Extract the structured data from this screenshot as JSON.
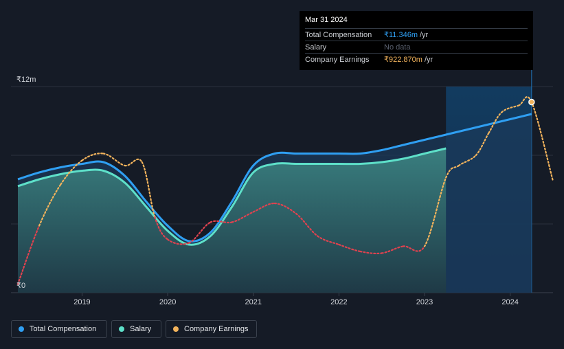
{
  "chart_data": {
    "type": "line",
    "y_axis": {
      "ticks": [
        {
          "value": 0,
          "label": "₹0"
        },
        {
          "value": 12,
          "label": "₹12m"
        }
      ],
      "ylim": [
        0,
        12
      ]
    },
    "x_axis": {
      "ticks": [
        "2019",
        "2020",
        "2021",
        "2022",
        "2023",
        "2024"
      ],
      "xlim": [
        2018.17,
        2024.5
      ]
    },
    "series": [
      {
        "name": "Total Compensation",
        "color": "#2f9ff2",
        "x": [
          2018.25,
          2018.5,
          2018.75,
          2019.0,
          2019.25,
          2019.5,
          2019.75,
          2020.0,
          2020.25,
          2020.5,
          2020.75,
          2021.0,
          2021.25,
          2021.5,
          2021.75,
          2022.0,
          2022.25,
          2022.5,
          2022.75,
          2023.0,
          2023.25,
          2023.5,
          2023.75,
          2024.0,
          2024.25
        ],
        "values": [
          6.6,
          7.0,
          7.3,
          7.5,
          7.6,
          6.8,
          5.3,
          3.9,
          3.0,
          3.5,
          5.3,
          7.4,
          8.1,
          8.1,
          8.1,
          8.1,
          8.1,
          8.3,
          8.6,
          8.9,
          9.2,
          9.5,
          9.8,
          10.1,
          10.4
        ]
      },
      {
        "name": "Salary",
        "color": "#5ee0c9",
        "x": [
          2018.25,
          2018.5,
          2018.75,
          2019.0,
          2019.25,
          2019.5,
          2019.75,
          2020.0,
          2020.25,
          2020.5,
          2020.75,
          2021.0,
          2021.25,
          2021.5,
          2021.75,
          2022.0,
          2022.25,
          2022.5,
          2022.75,
          2023.0,
          2023.25
        ],
        "values": [
          6.2,
          6.6,
          6.9,
          7.1,
          7.1,
          6.4,
          5.0,
          3.6,
          2.8,
          3.3,
          5.0,
          7.0,
          7.5,
          7.5,
          7.5,
          7.5,
          7.5,
          7.6,
          7.8,
          8.1,
          8.4
        ]
      },
      {
        "name": "Company Earnings",
        "colors": {
          "positive": "#f2b35c",
          "negative": "#e0424f"
        },
        "x": [
          2018.25,
          2018.5,
          2018.75,
          2019.0,
          2019.25,
          2019.5,
          2019.7,
          2019.85,
          2020.0,
          2020.25,
          2020.5,
          2020.75,
          2021.0,
          2021.25,
          2021.5,
          2021.75,
          2022.0,
          2022.25,
          2022.5,
          2022.75,
          2023.0,
          2023.25,
          2023.4,
          2023.6,
          2023.75,
          2023.9,
          2024.1,
          2024.25,
          2024.5
        ],
        "values": [
          0.5,
          3.9,
          6.3,
          7.7,
          8.1,
          7.4,
          7.6,
          4.4,
          3.1,
          2.9,
          4.1,
          4.1,
          4.7,
          5.2,
          4.6,
          3.3,
          2.8,
          2.4,
          2.3,
          2.7,
          2.7,
          6.7,
          7.4,
          8.0,
          9.3,
          10.5,
          10.9,
          11.1,
          6.5
        ]
      }
    ],
    "highlight": {
      "start": 2023.25,
      "end": 2024.25
    },
    "marker": {
      "x": 2024.25,
      "y": 11.1
    }
  },
  "tooltip": {
    "title": "Mar 31 2024",
    "rows": [
      {
        "label": "Total Compensation",
        "value": "₹11.346m",
        "unit": "/yr"
      },
      {
        "label": "Salary",
        "value": "No data",
        "unit": ""
      },
      {
        "label": "Company Earnings",
        "value": "₹922.870m",
        "unit": "/yr"
      }
    ]
  },
  "legend": [
    {
      "label": "Total Compensation",
      "color": "#2f9ff2"
    },
    {
      "label": "Salary",
      "color": "#5ee0c9"
    },
    {
      "label": "Company Earnings",
      "color": "#f2b35c"
    }
  ]
}
